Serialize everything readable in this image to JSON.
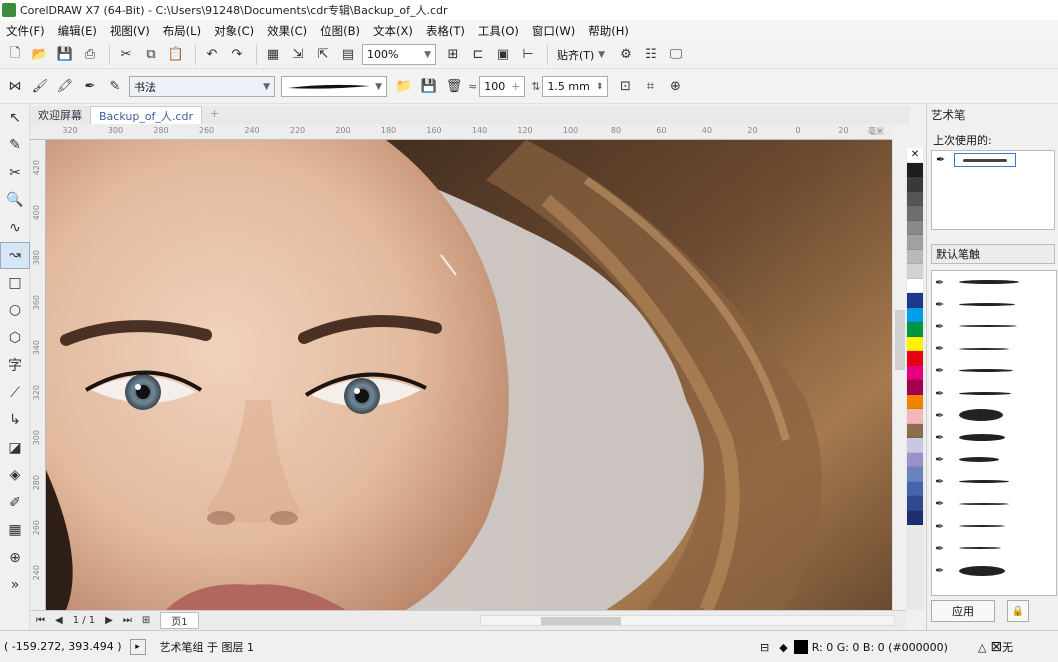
{
  "window": {
    "title": "CorelDRAW X7 (64-Bit) - C:\\Users\\91248\\Documents\\cdr专辑\\Backup_of_人.cdr"
  },
  "menu": [
    "文件(F)",
    "编辑(E)",
    "视图(V)",
    "布局(L)",
    "对象(C)",
    "效果(C)",
    "位图(B)",
    "文本(X)",
    "表格(T)",
    "工具(O)",
    "窗口(W)",
    "帮助(H)"
  ],
  "standard_toolbar": {
    "zoom": "100%",
    "snap_label": "贴齐(T)"
  },
  "property_bar": {
    "preset": "书法",
    "width_value": "100",
    "size_value": "1.5 mm"
  },
  "tabs": [
    "欢迎屏幕",
    "Backup_of_人.cdr",
    "+"
  ],
  "ruler": {
    "h_ticks": [
      "320",
      "300",
      "280",
      "260",
      "240",
      "220",
      "200",
      "180",
      "160",
      "140",
      "120",
      "100",
      "80",
      "60",
      "40",
      "20",
      "0",
      "20"
    ],
    "h_unit": "毫米",
    "v_ticks": [
      "420",
      "400",
      "380",
      "360",
      "340",
      "320",
      "300",
      "280",
      "260",
      "240"
    ]
  },
  "palette_colors": [
    "#1e1e1e",
    "#3a3a3a",
    "#555555",
    "#6e6e6e",
    "#888888",
    "#a1a1a1",
    "#b9b9b9",
    "#d2d2d2",
    "#ffffff",
    "#1b3a8c",
    "#00a0e9",
    "#00963f",
    "#fff100",
    "#e60012",
    "#e5007f",
    "#a40050",
    "#f08300",
    "#f2b8b8",
    "#8c6d4f",
    "#c7c7e6",
    "#9d8fc7",
    "#6b83bf",
    "#4864ae",
    "#2f4a8f",
    "#1e3070"
  ],
  "docker": {
    "title": "艺术笔",
    "recent_label": "上次使用的:",
    "style_label": "默认笔触",
    "apply_label": "应用"
  },
  "page_nav": {
    "page_count": "1 / 1",
    "page_tab": "页1"
  },
  "status": {
    "coords": "( -159.272, 393.494 )",
    "object_info": "艺术笔组 于 图层 1",
    "fill_info": "R: 0 G: 0 B: 0 (#000000)",
    "outline_info": "无"
  }
}
